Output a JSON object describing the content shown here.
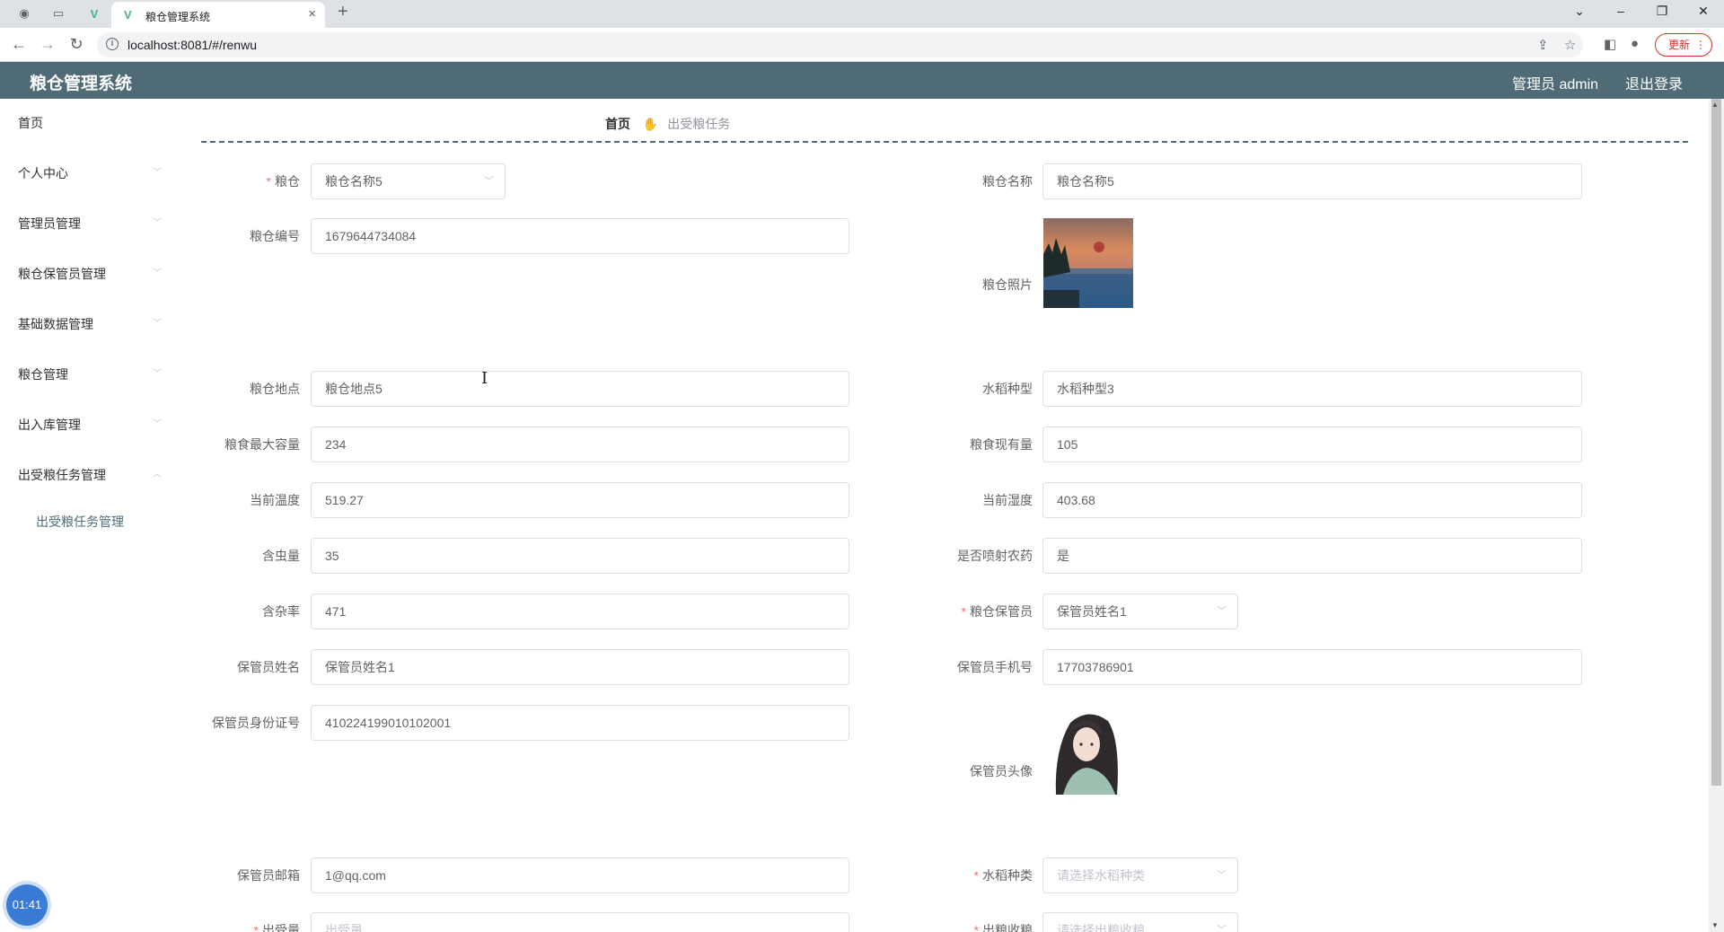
{
  "browser": {
    "tab_title": "粮仓管理系统",
    "url": "localhost:8081/#/renwu",
    "update_label": "更新"
  },
  "app": {
    "title": "粮仓管理系统",
    "user": "管理员 admin",
    "logout": "退出登录"
  },
  "sidebar": {
    "items": [
      {
        "label": "首页"
      },
      {
        "label": "个人中心"
      },
      {
        "label": "管理员管理"
      },
      {
        "label": "粮仓保管员管理"
      },
      {
        "label": "基础数据管理"
      },
      {
        "label": "粮仓管理"
      },
      {
        "label": "出入库管理"
      },
      {
        "label": "出受粮任务管理"
      }
    ],
    "submenu": "出受粮任务管理"
  },
  "breadcrumb": {
    "home": "首页",
    "current": "出受粮任务"
  },
  "form": {
    "granary": {
      "label": "粮仓",
      "value": "粮仓名称5"
    },
    "granary_name": {
      "label": "粮仓名称",
      "value": "粮仓名称5"
    },
    "granary_code": {
      "label": "粮仓编号",
      "value": "1679644734084"
    },
    "granary_photo": {
      "label": "粮仓照片"
    },
    "granary_location": {
      "label": "粮仓地点",
      "value": "粮仓地点5"
    },
    "rice_variety": {
      "label": "水稻种型",
      "value": "水稻种型3"
    },
    "max_capacity": {
      "label": "粮食最大容量",
      "value": "234"
    },
    "current_amount": {
      "label": "粮食现有量",
      "value": "105"
    },
    "temperature": {
      "label": "当前温度",
      "value": "519.27"
    },
    "humidity": {
      "label": "当前湿度",
      "value": "403.68"
    },
    "insects": {
      "label": "含虫量",
      "value": "35"
    },
    "pesticide": {
      "label": "是否喷射农药",
      "value": "是"
    },
    "impurity": {
      "label": "含杂率",
      "value": "471"
    },
    "keeper": {
      "label": "粮仓保管员",
      "value": "保管员姓名1"
    },
    "keeper_name": {
      "label": "保管员姓名",
      "value": "保管员姓名1"
    },
    "keeper_phone": {
      "label": "保管员手机号",
      "value": "17703786901"
    },
    "keeper_id": {
      "label": "保管员身份证号",
      "value": "410224199010102001"
    },
    "keeper_avatar": {
      "label": "保管员头像"
    },
    "keeper_email": {
      "label": "保管员邮箱",
      "value": "1@qq.com"
    },
    "rice_type": {
      "label": "水稻种类",
      "placeholder": "请选择水稻种类"
    },
    "out_amount": {
      "label": "出受量",
      "placeholder": "出受量"
    },
    "out_receive": {
      "label": "出粮收粮",
      "placeholder": "请选择出粮收粮"
    }
  },
  "timer": "01:41",
  "colors": {
    "header": "#4f6b77",
    "required": "#f56c6c"
  }
}
